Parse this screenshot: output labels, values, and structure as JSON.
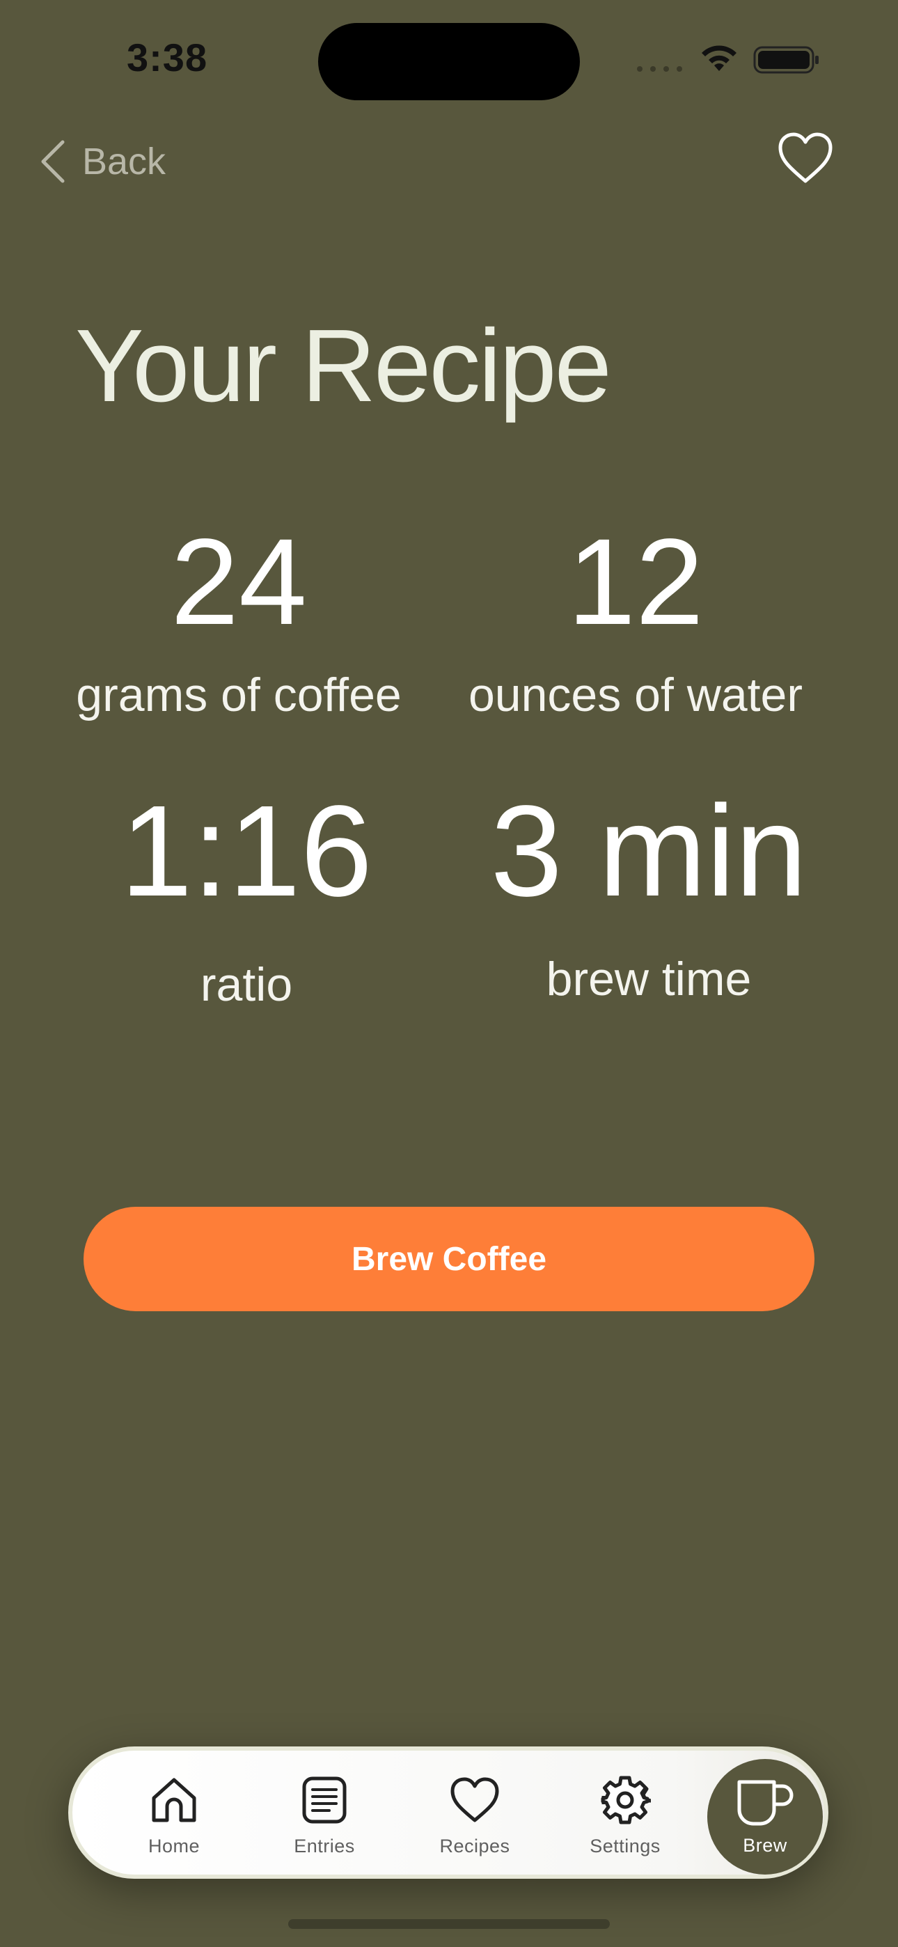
{
  "status_bar": {
    "time": "3:38"
  },
  "nav": {
    "back_label": "Back",
    "back_icon": "chevron-left-icon",
    "favorite_icon": "heart-icon"
  },
  "title": "Your Recipe",
  "stats": {
    "coffee": {
      "value": "24",
      "label": "grams of coffee"
    },
    "water": {
      "value": "12",
      "label": "ounces of water"
    },
    "ratio": {
      "value": "1:16",
      "label": "ratio"
    },
    "brew_time": {
      "value": "3 min",
      "label": "brew time"
    }
  },
  "brew_button": {
    "label": "Brew Coffee"
  },
  "tab_bar": {
    "items": [
      {
        "label": "Home",
        "icon": "home-icon"
      },
      {
        "label": "Entries",
        "icon": "entries-icon"
      },
      {
        "label": "Recipes",
        "icon": "heart-icon"
      },
      {
        "label": "Settings",
        "icon": "gear-icon"
      },
      {
        "label": "Brew",
        "icon": "cup-icon",
        "active": true
      }
    ]
  },
  "colors": {
    "background": "#58573d",
    "accent": "#fe7e38",
    "tab_bar": "#ffffff"
  }
}
